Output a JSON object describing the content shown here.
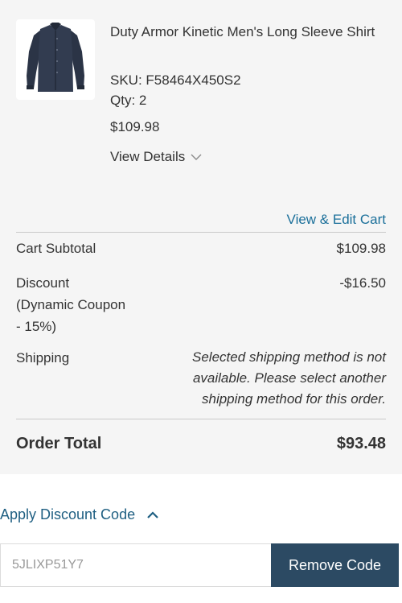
{
  "item": {
    "name": "Duty Armor Kinetic Men's Long Sleeve Shirt",
    "sku": "SKU: F58464X450S2",
    "qty": "Qty: 2",
    "price": "$109.98",
    "view_details_label": "View Details",
    "image_icon": "long-sleeve-shirt-image"
  },
  "cart": {
    "edit_link": "View & Edit Cart",
    "subtotal_label": "Cart Subtotal",
    "subtotal_value": "$109.98",
    "discount_label": "Discount (Dynamic Coupon - 15%)",
    "discount_value": "-$16.50",
    "shipping_label": "Shipping",
    "shipping_message": "Selected shipping method is not available. Please select another shipping method for this order.",
    "total_label": "Order Total",
    "total_value": "$93.48"
  },
  "discount": {
    "toggle_label": "Apply Discount Code",
    "code_value": "5JLIXP51Y7",
    "button_label": "Remove Code"
  },
  "colors": {
    "link": "#1a6f9a",
    "button_bg": "#2c4a63",
    "panel_bg": "#f5f5f5"
  }
}
